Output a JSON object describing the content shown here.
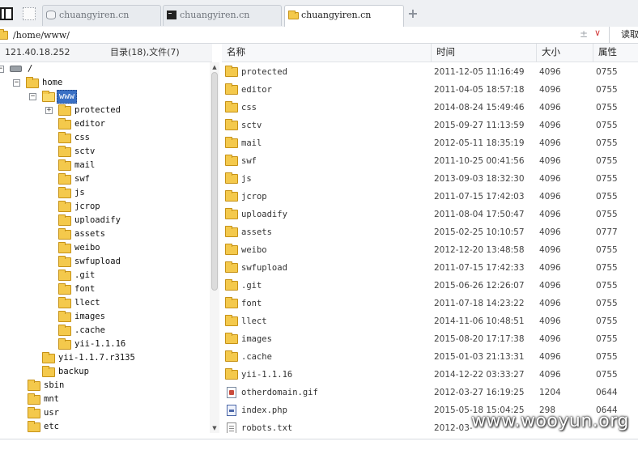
{
  "tabs": [
    {
      "label": "chuangyiren.cn",
      "icon": "database-icon",
      "active": false
    },
    {
      "label": "chuangyiren.cn",
      "icon": "terminal-icon",
      "active": false
    },
    {
      "label": "chuangyiren.cn",
      "icon": "folder-icon",
      "active": true
    }
  ],
  "new_tab": "+",
  "address": {
    "path": "/home/www/",
    "read_label": "读取",
    "sort_glyph": "±",
    "dropdown_glyph": "∨"
  },
  "tree_header": {
    "host": "121.40.18.252",
    "summary": "目录(18),文件(7)"
  },
  "tree": [
    {
      "label": "/",
      "expander": "−",
      "kind": "root"
    },
    {
      "label": "home",
      "expander": "−",
      "kind": "folder"
    },
    {
      "label": "www",
      "expander": "−",
      "kind": "folder-open",
      "selected": true
    },
    {
      "label": "protected",
      "expander": "+",
      "kind": "folder"
    },
    {
      "label": "editor",
      "expander": "",
      "kind": "folder"
    },
    {
      "label": "css",
      "expander": "",
      "kind": "folder"
    },
    {
      "label": "sctv",
      "expander": "",
      "kind": "folder"
    },
    {
      "label": "mail",
      "expander": "",
      "kind": "folder"
    },
    {
      "label": "swf",
      "expander": "",
      "kind": "folder"
    },
    {
      "label": "js",
      "expander": "",
      "kind": "folder"
    },
    {
      "label": "jcrop",
      "expander": "",
      "kind": "folder"
    },
    {
      "label": "uploadify",
      "expander": "",
      "kind": "folder"
    },
    {
      "label": "assets",
      "expander": "",
      "kind": "folder"
    },
    {
      "label": "weibo",
      "expander": "",
      "kind": "folder"
    },
    {
      "label": "swfupload",
      "expander": "",
      "kind": "folder"
    },
    {
      "label": ".git",
      "expander": "",
      "kind": "folder"
    },
    {
      "label": "font",
      "expander": "",
      "kind": "folder"
    },
    {
      "label": "llect",
      "expander": "",
      "kind": "folder"
    },
    {
      "label": "images",
      "expander": "",
      "kind": "folder"
    },
    {
      "label": ".cache",
      "expander": "",
      "kind": "folder"
    },
    {
      "label": "yii-1.1.16",
      "expander": "",
      "kind": "folder"
    },
    {
      "label": "yii-1.1.7.r3135",
      "expander": "",
      "kind": "folder"
    },
    {
      "label": "backup",
      "expander": "",
      "kind": "folder"
    },
    {
      "label": "sbin",
      "expander": "",
      "kind": "folder"
    },
    {
      "label": "mnt",
      "expander": "",
      "kind": "folder"
    },
    {
      "label": "usr",
      "expander": "",
      "kind": "folder"
    },
    {
      "label": "etc",
      "expander": "",
      "kind": "folder"
    }
  ],
  "columns": {
    "name": "名称",
    "time": "时间",
    "size": "大小",
    "attr": "属性"
  },
  "files": [
    {
      "name": "protected",
      "time": "2011-12-05 11:16:49",
      "size": "4096",
      "attr": "0755",
      "type": "folder"
    },
    {
      "name": "editor",
      "time": "2011-04-05 18:57:18",
      "size": "4096",
      "attr": "0755",
      "type": "folder"
    },
    {
      "name": "css",
      "time": "2014-08-24 15:49:46",
      "size": "4096",
      "attr": "0755",
      "type": "folder"
    },
    {
      "name": "sctv",
      "time": "2015-09-27 11:13:59",
      "size": "4096",
      "attr": "0755",
      "type": "folder"
    },
    {
      "name": "mail",
      "time": "2012-05-11 18:35:19",
      "size": "4096",
      "attr": "0755",
      "type": "folder"
    },
    {
      "name": "swf",
      "time": "2011-10-25 00:41:56",
      "size": "4096",
      "attr": "0755",
      "type": "folder"
    },
    {
      "name": "js",
      "time": "2013-09-03 18:32:30",
      "size": "4096",
      "attr": "0755",
      "type": "folder"
    },
    {
      "name": "jcrop",
      "time": "2011-07-15 17:42:03",
      "size": "4096",
      "attr": "0755",
      "type": "folder"
    },
    {
      "name": "uploadify",
      "time": "2011-08-04 17:50:47",
      "size": "4096",
      "attr": "0755",
      "type": "folder"
    },
    {
      "name": "assets",
      "time": "2015-02-25 10:10:57",
      "size": "4096",
      "attr": "0777",
      "type": "folder"
    },
    {
      "name": "weibo",
      "time": "2012-12-20 13:48:58",
      "size": "4096",
      "attr": "0755",
      "type": "folder"
    },
    {
      "name": "swfupload",
      "time": "2011-07-15 17:42:33",
      "size": "4096",
      "attr": "0755",
      "type": "folder"
    },
    {
      "name": ".git",
      "time": "2015-06-26 12:26:07",
      "size": "4096",
      "attr": "0755",
      "type": "folder"
    },
    {
      "name": "font",
      "time": "2011-07-18 14:23:22",
      "size": "4096",
      "attr": "0755",
      "type": "folder"
    },
    {
      "name": "llect",
      "time": "2014-11-06 10:48:51",
      "size": "4096",
      "attr": "0755",
      "type": "folder"
    },
    {
      "name": "images",
      "time": "2015-08-20 17:17:38",
      "size": "4096",
      "attr": "0755",
      "type": "folder"
    },
    {
      "name": ".cache",
      "time": "2015-01-03 21:13:31",
      "size": "4096",
      "attr": "0755",
      "type": "folder"
    },
    {
      "name": "yii-1.1.16",
      "time": "2014-12-22 03:33:27",
      "size": "4096",
      "attr": "0755",
      "type": "folder"
    },
    {
      "name": "otherdomain.gif",
      "time": "2012-03-27 16:19:25",
      "size": "1204",
      "attr": "0644",
      "type": "image"
    },
    {
      "name": "index.php",
      "time": "2015-05-18 15:04:25",
      "size": "298",
      "attr": "0644",
      "type": "php"
    },
    {
      "name": "robots.txt",
      "time": "2012-03-",
      "size": "",
      "attr": "",
      "type": "text"
    }
  ],
  "watermark": "www.wooyun.org",
  "colors": {
    "selection": "#3a70c4",
    "folder": "#f4c94c",
    "tab_bar": "#eef0f3"
  }
}
